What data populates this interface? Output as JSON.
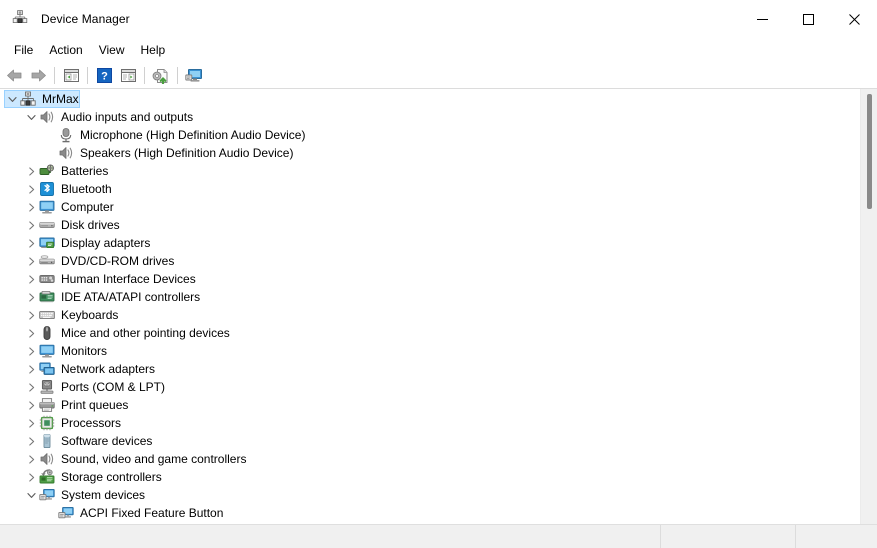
{
  "window": {
    "title": "Device Manager",
    "icon": "device-manager-icon",
    "controls": {
      "minimize": "Minimize",
      "maximize": "Maximize",
      "close": "Close"
    }
  },
  "menubar": {
    "items": [
      {
        "label": "File",
        "name": "menu-file"
      },
      {
        "label": "Action",
        "name": "menu-action"
      },
      {
        "label": "View",
        "name": "menu-view"
      },
      {
        "label": "Help",
        "name": "menu-help"
      }
    ]
  },
  "toolbar": {
    "buttons": [
      {
        "name": "back-arrow-icon",
        "tooltip": "Back"
      },
      {
        "name": "forward-arrow-icon",
        "tooltip": "Forward"
      },
      {
        "name": "separator-1",
        "tooltip": ""
      },
      {
        "name": "show-hide-console-tree-icon",
        "tooltip": "Show/Hide Console Tree"
      },
      {
        "name": "separator-2",
        "tooltip": ""
      },
      {
        "name": "help-icon",
        "tooltip": "Help"
      },
      {
        "name": "properties-icon",
        "tooltip": "Properties"
      },
      {
        "name": "separator-3",
        "tooltip": ""
      },
      {
        "name": "update-driver-icon",
        "tooltip": "Update driver"
      },
      {
        "name": "separator-4",
        "tooltip": ""
      },
      {
        "name": "scan-for-hardware-changes-icon",
        "tooltip": "Scan for hardware changes"
      }
    ]
  },
  "tree": {
    "selected_index": 0,
    "nodes": [
      {
        "label": "MrMax",
        "indent": 0,
        "state": "expanded",
        "icon": "computer-root-icon",
        "selected": true
      },
      {
        "label": "Audio inputs and outputs",
        "indent": 1,
        "state": "expanded",
        "icon": "speaker-icon",
        "selected": false
      },
      {
        "label": "Microphone (High Definition Audio Device)",
        "indent": 2,
        "state": "leaf",
        "icon": "microphone-icon",
        "selected": false
      },
      {
        "label": "Speakers (High Definition Audio Device)",
        "indent": 2,
        "state": "leaf",
        "icon": "speaker-icon",
        "selected": false
      },
      {
        "label": "Batteries",
        "indent": 1,
        "state": "collapsed",
        "icon": "battery-icon",
        "selected": false
      },
      {
        "label": "Bluetooth",
        "indent": 1,
        "state": "collapsed",
        "icon": "bluetooth-icon",
        "selected": false
      },
      {
        "label": "Computer",
        "indent": 1,
        "state": "collapsed",
        "icon": "monitor-icon",
        "selected": false
      },
      {
        "label": "Disk drives",
        "indent": 1,
        "state": "collapsed",
        "icon": "disk-drive-icon",
        "selected": false
      },
      {
        "label": "Display adapters",
        "indent": 1,
        "state": "collapsed",
        "icon": "display-adapter-icon",
        "selected": false
      },
      {
        "label": "DVD/CD-ROM drives",
        "indent": 1,
        "state": "collapsed",
        "icon": "dvd-drive-icon",
        "selected": false
      },
      {
        "label": "Human Interface Devices",
        "indent": 1,
        "state": "collapsed",
        "icon": "hid-icon",
        "selected": false
      },
      {
        "label": "IDE ATA/ATAPI controllers",
        "indent": 1,
        "state": "collapsed",
        "icon": "ide-controller-icon",
        "selected": false
      },
      {
        "label": "Keyboards",
        "indent": 1,
        "state": "collapsed",
        "icon": "keyboard-icon",
        "selected": false
      },
      {
        "label": "Mice and other pointing devices",
        "indent": 1,
        "state": "collapsed",
        "icon": "mouse-icon",
        "selected": false
      },
      {
        "label": "Monitors",
        "indent": 1,
        "state": "collapsed",
        "icon": "monitor-icon",
        "selected": false
      },
      {
        "label": "Network adapters",
        "indent": 1,
        "state": "collapsed",
        "icon": "network-adapter-icon",
        "selected": false
      },
      {
        "label": "Ports (COM & LPT)",
        "indent": 1,
        "state": "collapsed",
        "icon": "port-icon",
        "selected": false
      },
      {
        "label": "Print queues",
        "indent": 1,
        "state": "collapsed",
        "icon": "printer-icon",
        "selected": false
      },
      {
        "label": "Processors",
        "indent": 1,
        "state": "collapsed",
        "icon": "processor-icon",
        "selected": false
      },
      {
        "label": "Software devices",
        "indent": 1,
        "state": "collapsed",
        "icon": "software-device-icon",
        "selected": false
      },
      {
        "label": "Sound, video and game controllers",
        "indent": 1,
        "state": "collapsed",
        "icon": "speaker-icon",
        "selected": false
      },
      {
        "label": "Storage controllers",
        "indent": 1,
        "state": "collapsed",
        "icon": "storage-controller-icon",
        "selected": false
      },
      {
        "label": "System devices",
        "indent": 1,
        "state": "expanded",
        "icon": "system-device-icon",
        "selected": false
      },
      {
        "label": "ACPI Fixed Feature Button",
        "indent": 2,
        "state": "leaf",
        "icon": "system-device-icon",
        "selected": false
      }
    ]
  },
  "statusbar": {
    "left_text": "",
    "middle_text": "",
    "right_text": ""
  },
  "colors": {
    "selection_fill": "#cce8ff",
    "selection_border": "#99d1ff",
    "text": "#000000",
    "window_bg": "#ffffff",
    "statusbar_bg": "#f0f0f0",
    "scrollbar_track": "#f0f0f0",
    "scrollbar_thumb": "#8a8a8a",
    "accent_blue": "#2c8fd6",
    "accent_green": "#4a9e3f"
  }
}
